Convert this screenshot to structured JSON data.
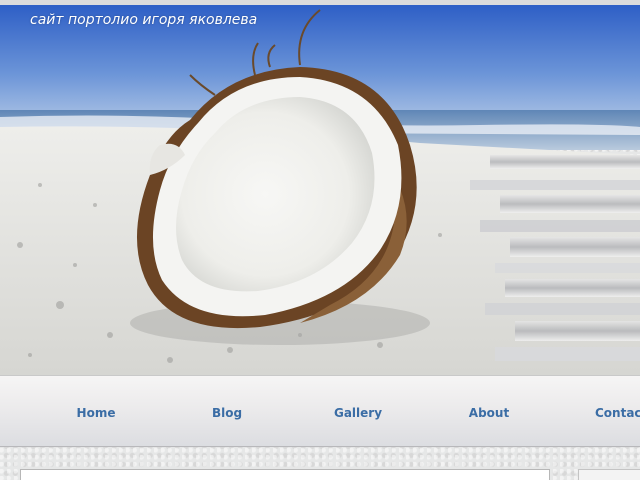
{
  "site": {
    "title": "сайт портолио игоря яковлева"
  },
  "header": {
    "image_description_icon": "coconut-on-beach-image"
  },
  "nav": {
    "items": [
      {
        "label": "Home"
      },
      {
        "label": "Blog"
      },
      {
        "label": "Gallery"
      },
      {
        "label": "About"
      },
      {
        "label": "Contact"
      }
    ]
  },
  "colors": {
    "nav_text": "#3b6da5",
    "sky": "#3d6fc9",
    "sand": "#e7e6e2"
  }
}
